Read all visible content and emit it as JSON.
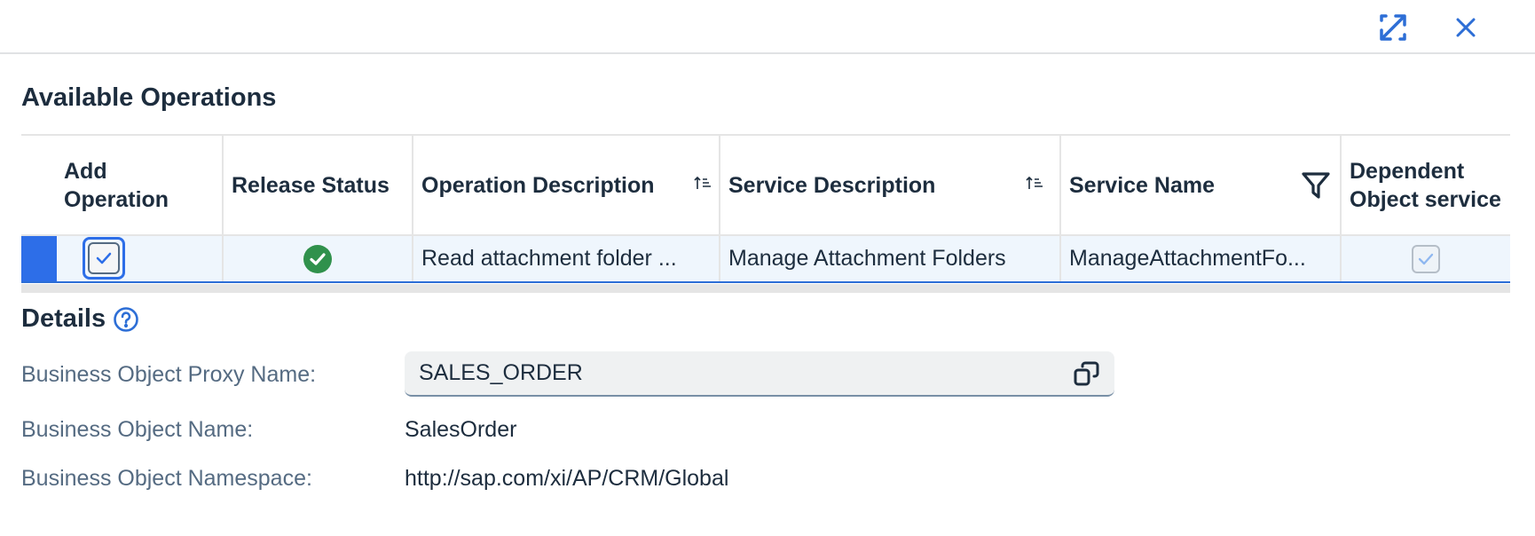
{
  "dialog": {
    "expand_label": "Expand",
    "close_label": "Close"
  },
  "operations": {
    "title": "Available Operations",
    "columns": [
      {
        "label": "Add Operation"
      },
      {
        "label": "Release Status"
      },
      {
        "label": "Operation Description",
        "sort": "ascending"
      },
      {
        "label": "Service Description",
        "sort": "ascending"
      },
      {
        "label": "Service Name",
        "filter": true
      },
      {
        "label": "Dependent Object service"
      }
    ],
    "rows": [
      {
        "selected": true,
        "add_operation": true,
        "release_status": "released",
        "operation_description": "Read attachment folder ...",
        "service_description": "Manage Attachment Folders",
        "service_name": "ManageAttachmentFo...",
        "dependent_object_service": true
      }
    ]
  },
  "details": {
    "title": "Details",
    "fields": [
      {
        "label": "Business Object Proxy Name:",
        "value": "SALES_ORDER"
      },
      {
        "label": "Business Object Name:",
        "value": "SalesOrder"
      },
      {
        "label": "Business Object Namespace:",
        "value": "http://sap.com/xi/AP/CRM/Global"
      }
    ]
  },
  "colors": {
    "accent": "#2d6ee8",
    "success": "#30914c",
    "text": "#1d2d3e",
    "label": "#556b82",
    "row_selected_bg": "#eff6fd"
  }
}
